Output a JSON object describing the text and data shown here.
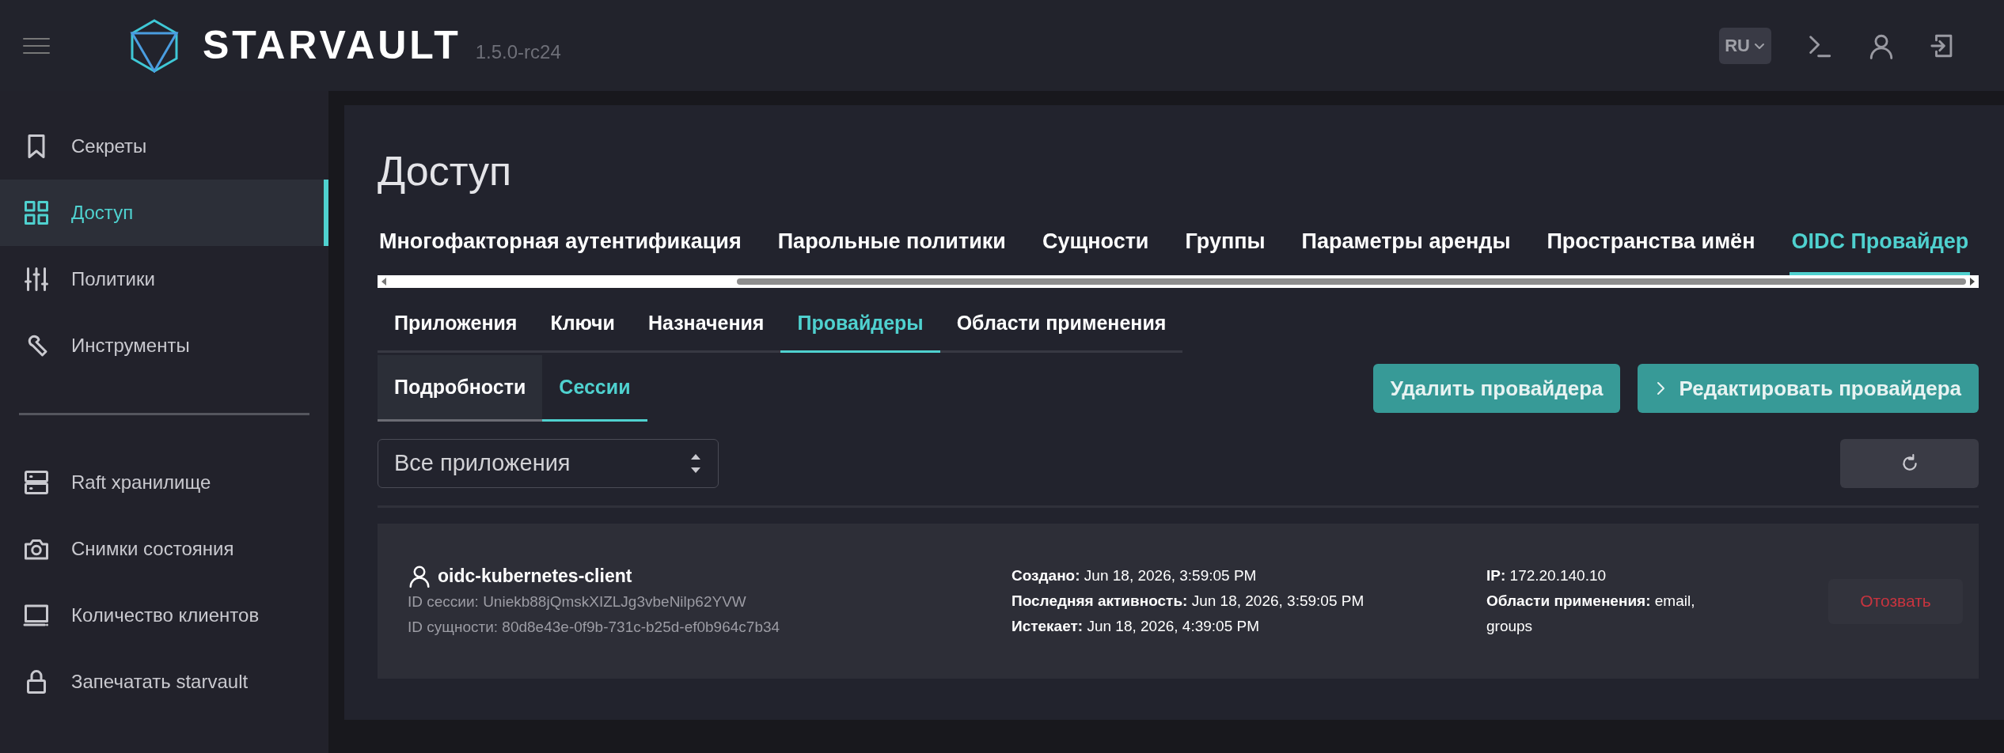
{
  "header": {
    "brand": "STARVAULT",
    "version": "1.5.0-rc24",
    "language": "RU"
  },
  "sidebar": {
    "items": [
      {
        "label": "Секреты",
        "selected": false
      },
      {
        "label": "Доступ",
        "selected": true
      },
      {
        "label": "Политики",
        "selected": false
      },
      {
        "label": "Инструменты",
        "selected": false
      }
    ],
    "secondary_items": [
      {
        "label": "Raft хранилище",
        "selected": false
      },
      {
        "label": "Снимки состояния",
        "selected": false
      },
      {
        "label": "Количество клиентов",
        "selected": false
      },
      {
        "label": "Запечатать starvault",
        "selected": false
      }
    ]
  },
  "main": {
    "title": "Доступ",
    "tabs": [
      {
        "label": "Многофакторная аутентификация",
        "selected": false
      },
      {
        "label": "Парольные политики",
        "selected": false
      },
      {
        "label": "Сущности",
        "selected": false
      },
      {
        "label": "Группы",
        "selected": false
      },
      {
        "label": "Параметры аренды",
        "selected": false
      },
      {
        "label": "Пространства имён",
        "selected": false
      },
      {
        "label": "OIDC Провайдер",
        "selected": true
      }
    ],
    "subtabs": [
      {
        "label": "Приложения",
        "selected": false
      },
      {
        "label": "Ключи",
        "selected": false
      },
      {
        "label": "Назначения",
        "selected": false
      },
      {
        "label": "Провайдеры",
        "selected": true
      },
      {
        "label": "Области применения",
        "selected": false
      }
    ],
    "view_tabs": [
      {
        "label": "Подробности",
        "selected": false
      },
      {
        "label": "Сессии",
        "selected": true
      }
    ],
    "actions": [
      {
        "label": "Удалить провайдера",
        "kind": "plain"
      },
      {
        "label": "Редактировать провайдера",
        "kind": "chevron"
      }
    ],
    "filter": {
      "value": "Все приложения"
    },
    "sessions": [
      {
        "client": "oidc-kubernetes-client",
        "session_id": "ID сессии: Uniekb88jQmskXIZLJg3vbeNilp62YVW",
        "entity_id": "ID сущности: 80d8e43e-0f9b-731c-b25d-ef0b964c7b34",
        "times": [
          "**Создано:** Jun 18, 2026, 3:59:05 PM",
          "**Последняя активность:** Jun 18, 2026, 3:59:05 PM",
          "**Истекает:** Jun 18, 2026, 4:39:05 PM"
        ],
        "details": [
          "**IP:** 172.20.140.10",
          "**Области применения:** email, groups"
        ],
        "revoke": "Отозвать"
      }
    ]
  }
}
